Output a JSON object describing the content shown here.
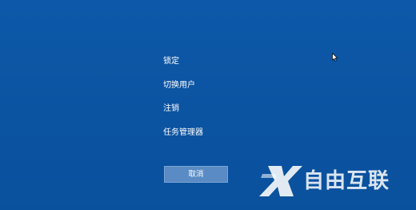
{
  "security_options": {
    "items": [
      {
        "label": "锁定"
      },
      {
        "label": "切换用户"
      },
      {
        "label": "注销"
      },
      {
        "label": "任务管理器"
      }
    ],
    "cancel_label": "取消"
  },
  "watermark": {
    "text": "自由互联",
    "icon": "x-logo-icon"
  },
  "colors": {
    "background": "#0c56a6",
    "button": "#5a8bc4",
    "text": "#ffffff"
  }
}
